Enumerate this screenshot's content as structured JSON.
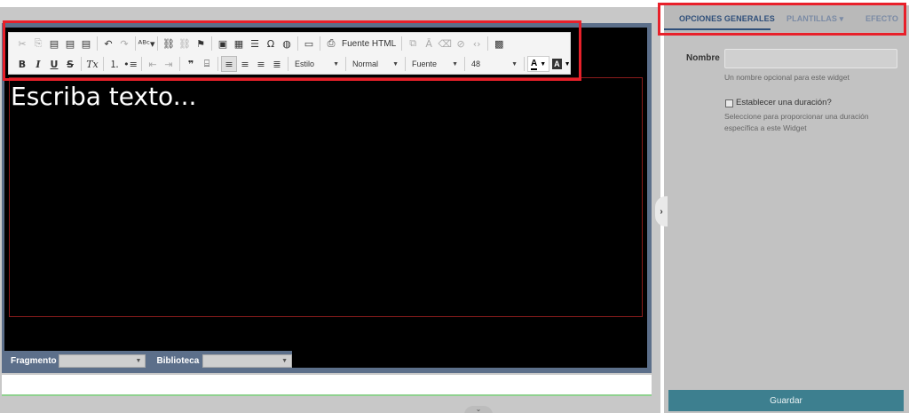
{
  "editor": {
    "placeholder_text": "Escriba texto...",
    "toolbar": {
      "row1": [
        {
          "name": "cut-icon",
          "glyph": "✂",
          "dim": true
        },
        {
          "name": "copy-icon",
          "glyph": "⎘",
          "dim": true
        },
        {
          "name": "paste-icon",
          "glyph": "▤"
        },
        {
          "name": "paste-text-icon",
          "glyph": "▤"
        },
        {
          "name": "paste-word-icon",
          "glyph": "▤"
        },
        {
          "sep": true
        },
        {
          "name": "undo-icon",
          "glyph": "↶"
        },
        {
          "name": "redo-icon",
          "glyph": "↷",
          "dim": true
        },
        {
          "sep": true
        },
        {
          "name": "spellcheck-icon",
          "glyph": "ᴬᴮᶜ▾"
        },
        {
          "sep": true
        },
        {
          "name": "link-icon",
          "glyph": "⛓"
        },
        {
          "name": "unlink-icon",
          "glyph": "⛓",
          "dim": true
        },
        {
          "name": "anchor-flag-icon",
          "glyph": "⚑"
        },
        {
          "sep": true
        },
        {
          "name": "image-icon",
          "glyph": "▣"
        },
        {
          "name": "table-icon",
          "glyph": "▦"
        },
        {
          "name": "horizontal-rule-icon",
          "glyph": "☰"
        },
        {
          "name": "special-char-icon",
          "glyph": "Ω"
        },
        {
          "name": "globe-icon",
          "glyph": "◍"
        },
        {
          "sep": true
        },
        {
          "name": "maximize-icon",
          "glyph": "▭"
        },
        {
          "sep": true
        },
        {
          "name": "source-html-icon",
          "glyph": "⎙"
        }
      ],
      "source_label": "Fuente HTML",
      "row1_after": [
        {
          "sep": true
        },
        {
          "name": "find-icon",
          "glyph": "⧉",
          "dim": true
        },
        {
          "name": "replace-icon",
          "glyph": "Ā",
          "dim": true
        },
        {
          "name": "clear-format-icon",
          "glyph": "⌫",
          "dim": true
        },
        {
          "name": "remove-icon",
          "glyph": "⊘",
          "dim": true
        },
        {
          "name": "code-icon",
          "glyph": "‹›",
          "dim": true
        },
        {
          "sep": true
        },
        {
          "name": "qr-code-icon",
          "glyph": "▩"
        }
      ],
      "row2": [
        {
          "name": "bold-icon",
          "glyph": "B",
          "cls": "bold"
        },
        {
          "name": "italic-icon",
          "glyph": "I",
          "cls": "ital bold"
        },
        {
          "name": "underline-icon",
          "glyph": "U",
          "cls": "und bold"
        },
        {
          "name": "strikethrough-icon",
          "glyph": "S",
          "cls": "strike bold"
        },
        {
          "sep": true
        },
        {
          "name": "remove-format-icon",
          "glyph": "Tx",
          "cls": "ital"
        },
        {
          "sep": true
        },
        {
          "name": "numbered-list-icon",
          "glyph": "⒈"
        },
        {
          "name": "bulleted-list-icon",
          "glyph": "•≡"
        },
        {
          "sep": true
        },
        {
          "name": "decrease-indent-icon",
          "glyph": "⇤",
          "dim": true
        },
        {
          "name": "increase-indent-icon",
          "glyph": "⇥",
          "dim": true
        },
        {
          "sep": true
        },
        {
          "name": "blockquote-icon",
          "glyph": "❞",
          "cls": "bold"
        },
        {
          "name": "div-container-icon",
          "glyph": "⌸"
        },
        {
          "sep": true
        },
        {
          "name": "align-left-icon",
          "glyph": "≡",
          "cls": "active"
        },
        {
          "name": "align-center-icon",
          "glyph": "≡"
        },
        {
          "name": "align-right-icon",
          "glyph": "≡"
        },
        {
          "name": "align-justify-icon",
          "glyph": "≣"
        }
      ],
      "combos": {
        "style": "Estilo",
        "format": "Normal",
        "font": "Fuente",
        "size": "48"
      },
      "text_color_label": "A",
      "bg_color_label": "A"
    },
    "bottom": {
      "fragment_label": "Fragmento",
      "library_label": "Biblioteca"
    }
  },
  "panel": {
    "tabs": {
      "general": "OPCIONES GENERALES",
      "templates": "PLANTILLAS ▾",
      "effect": "EFECTO"
    },
    "name_label": "Nombre",
    "name_value": "",
    "name_help": "Un nombre opcional para este widget",
    "duration_label": "Establecer una duración?",
    "duration_checked": false,
    "duration_help_1": "Seleccione para proporcionar una duración",
    "duration_help_2": "específica a este Widget",
    "save_label": "Guardar"
  },
  "colors": {
    "accent": "#2f4f7a",
    "save_button": "#3d7f8f",
    "highlight_box": "#e8202a",
    "canvas": "#000000"
  }
}
